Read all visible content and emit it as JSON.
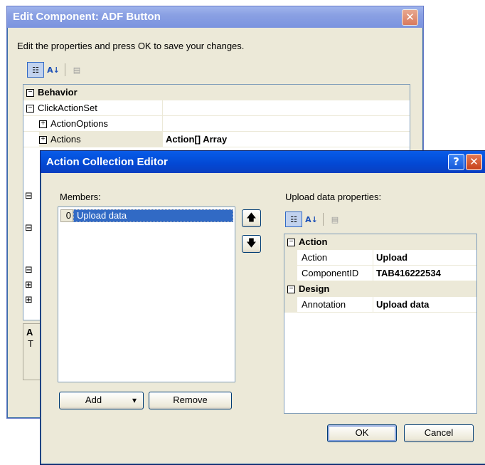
{
  "outer_dialog": {
    "title": "Edit Component: ADF Button",
    "close_glyph": "✕",
    "instructions": "Edit the properties and press OK to save your changes.",
    "categorized_glyph": "☷",
    "alphabetical_glyph": "A↓",
    "pages_glyph": "▤",
    "grid": {
      "behavior_category": "Behavior",
      "click_action_set": "ClickActionSet",
      "action_options": "ActionOptions",
      "actions_label": "Actions",
      "actions_value": "Action[] Array"
    },
    "hidden_rows": [
      "⊟",
      "⊟",
      "⊟",
      "⊞",
      "⊞"
    ],
    "desc_title": "A",
    "desc_text": "T"
  },
  "editor_dialog": {
    "title": "Action Collection Editor",
    "help_glyph": "?",
    "close_glyph": "✕",
    "members_label": "Members:",
    "members": [
      {
        "index": "0",
        "name": "Upload data"
      }
    ],
    "move_up_glyph": "🡅",
    "move_down_glyph": "🡇",
    "add_label": "Add",
    "add_dropdown_glyph": "▾",
    "remove_label": "Remove",
    "props_label": "Upload data properties:",
    "props": {
      "action_category": "Action",
      "action_name": "Action",
      "action_value": "Upload",
      "component_name": "ComponentID",
      "component_value": "TAB416222534",
      "design_category": "Design",
      "annotation_name": "Annotation",
      "annotation_value": "Upload data"
    },
    "ok_label": "OK",
    "cancel_label": "Cancel"
  },
  "colors": {
    "xp_blue_title": "#0348d3",
    "faded_title": "#8aa0e3",
    "dialog_face": "#ece9d8",
    "selection": "#316ac5"
  }
}
